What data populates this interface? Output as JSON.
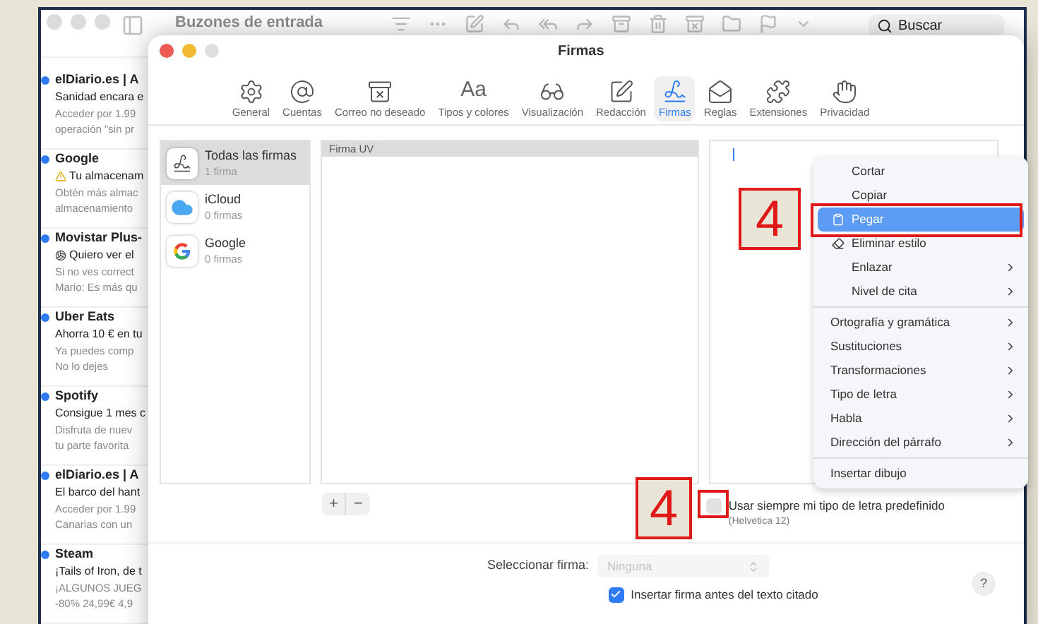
{
  "mail_window": {
    "title": "Buzones de entrada",
    "search": {
      "placeholder": "Buscar"
    }
  },
  "messages": [
    {
      "sender": "elDiario.es | A",
      "subject": "Sanidad encara e",
      "kind": "plain",
      "preview": [
        "Acceder por 1.99",
        "operación \"sin pr"
      ],
      "unread": true
    },
    {
      "sender": "Google",
      "subject": "Tu almacenam",
      "kind": "warning",
      "preview": [
        "Obtén más almac",
        "almacenamiento"
      ],
      "unread": true
    },
    {
      "sender": "Movistar Plus-",
      "subject": "Quiero ver el",
      "kind": "ball",
      "preview": [
        "Si no ves correct",
        "Mario: Es más qu"
      ],
      "unread": true
    },
    {
      "sender": "Uber Eats",
      "subject": "Ahorra 10 € en tu",
      "kind": "plain",
      "preview": [
        "Ya puedes comp",
        "No lo dejes"
      ],
      "unread": true
    },
    {
      "sender": "Spotify",
      "subject": "Consigue 1 mes c",
      "kind": "plain",
      "preview": [
        "Disfruta de nuev",
        "tu parte favorita"
      ],
      "unread": true
    },
    {
      "sender": "elDiario.es | A",
      "subject": "El barco del hant",
      "kind": "plain",
      "preview": [
        "Acceder por 1.99",
        "Canarias con un"
      ],
      "unread": true
    },
    {
      "sender": "Steam",
      "subject": "¡Tails of Iron, de t",
      "kind": "plain",
      "preview": [
        "¡ALGUNOS JUEG",
        "-80% 24,99€ 4,9"
      ],
      "unread": true
    }
  ],
  "dialog": {
    "title": "Firmas",
    "tabs": [
      {
        "label": "General",
        "kind": "gear",
        "selected": false
      },
      {
        "label": "Cuentas",
        "kind": "at",
        "selected": false
      },
      {
        "label": "Correo no deseado",
        "kind": "junk",
        "selected": false
      },
      {
        "label": "Tipos y colores",
        "kind": "text",
        "glyph": "Aa",
        "selected": false
      },
      {
        "label": "Visualización",
        "kind": "glasses",
        "selected": false
      },
      {
        "label": "Redacción",
        "kind": "compose",
        "selected": false
      },
      {
        "label": "Firmas",
        "kind": "signature",
        "selected": true
      },
      {
        "label": "Reglas",
        "kind": "rules",
        "selected": false
      },
      {
        "label": "Extensiones",
        "kind": "puzzle",
        "selected": false
      },
      {
        "label": "Privacidad",
        "kind": "hand",
        "selected": false
      }
    ],
    "accounts": [
      {
        "name": "Todas las firmas",
        "count": "1 firma",
        "kind": "all",
        "selected": true
      },
      {
        "name": "iCloud",
        "count": "0 firmas",
        "kind": "cloud",
        "selected": false
      },
      {
        "name": "Google",
        "count": "0 firmas",
        "kind": "google",
        "selected": false
      }
    ],
    "signatures": [
      {
        "name": "Firma UV",
        "selected": true
      }
    ],
    "add_button": "+",
    "remove_button": "−",
    "default_font": {
      "label": "Usar siempre mi tipo de letra predefinido",
      "font": "(Helvetica 12)",
      "checked": false
    },
    "select_signature": {
      "label": "Seleccionar firma:",
      "value": "Ninguna",
      "disabled": true
    },
    "insert_before_quote": {
      "label": "Insertar firma antes del texto citado",
      "checked": true
    },
    "help": "?"
  },
  "context_menu": [
    [
      {
        "label": "Cortar",
        "kind": "plain",
        "submenu": false,
        "selected": false
      },
      {
        "label": "Copiar",
        "kind": "plain",
        "submenu": false,
        "selected": false
      },
      {
        "label": "Pegar",
        "kind": "paste",
        "submenu": false,
        "selected": true
      },
      {
        "label": "Eliminar estilo",
        "kind": "clear-style",
        "submenu": false,
        "selected": false
      },
      {
        "label": "Enlazar",
        "kind": "plain",
        "submenu": true,
        "selected": false
      },
      {
        "label": "Nivel de cita",
        "kind": "plain",
        "submenu": true,
        "selected": false
      }
    ],
    [
      {
        "label": "Ortografía y gramática",
        "kind": "plain",
        "submenu": true,
        "selected": false
      },
      {
        "label": "Sustituciones",
        "kind": "plain",
        "submenu": true,
        "selected": false
      },
      {
        "label": "Transformaciones",
        "kind": "plain",
        "submenu": true,
        "selected": false
      },
      {
        "label": "Tipo de letra",
        "kind": "plain",
        "submenu": true,
        "selected": false
      },
      {
        "label": "Habla",
        "kind": "plain",
        "submenu": true,
        "selected": false
      },
      {
        "label": "Dirección del párrafo",
        "kind": "plain",
        "submenu": true,
        "selected": false
      }
    ],
    [
      {
        "label": "Insertar dibujo",
        "kind": "plain",
        "submenu": false,
        "selected": false
      }
    ]
  ],
  "callouts": [
    {
      "number": "4"
    },
    {
      "number": "4"
    }
  ]
}
